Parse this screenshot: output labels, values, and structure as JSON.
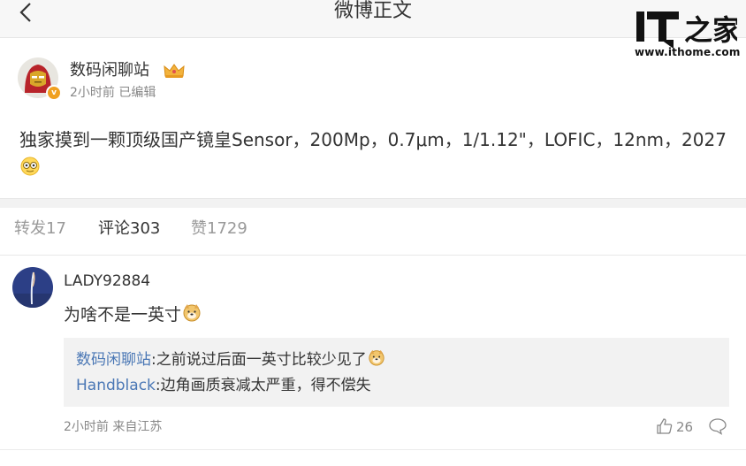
{
  "nav": {
    "title": "微博正文",
    "back_icon": "chevron-left-icon"
  },
  "watermark": {
    "logo_text": "IT之家",
    "url": "www.ithome.com"
  },
  "post": {
    "author": "数码闲聊站",
    "badge_icon": "crown-icon",
    "time_meta": "2小时前 已编辑",
    "text": "独家摸到一颗顶级国产镜皇Sensor，200Mp，0.7μm，1/1.12\"，LOFIC，12nm，2027",
    "trailing_emoji": "money-eyes-emoji"
  },
  "tabs": [
    {
      "label": "转发17",
      "active": false
    },
    {
      "label": "评论303",
      "active": true
    },
    {
      "label": "赞1729",
      "active": false
    }
  ],
  "comment": {
    "user": "LADY92884",
    "text": "为啥不是一英寸",
    "emoji": "doge-emoji",
    "replies": [
      {
        "user": "数码闲聊站",
        "text": ":之前说过后面一英寸比较少见了"
      },
      {
        "user": "Handblack",
        "text": ":边角画质衰减太严重，得不偿失"
      }
    ],
    "meta": "2小时前 来自江苏",
    "like_count": "26"
  },
  "colors": {
    "link_blue": "#4a77b5",
    "topbar_bg": "#f7f7f7",
    "reply_bg": "#f2f2f2"
  }
}
